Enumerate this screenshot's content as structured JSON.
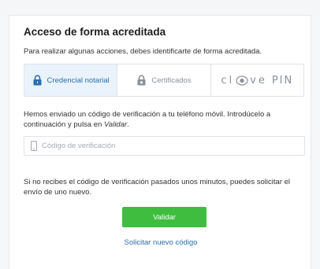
{
  "card": {
    "title": "Acceso de forma acreditada",
    "subtitle": "Para realizar algunas acciones, debes identificarte de forma acreditada."
  },
  "tabs": [
    {
      "label": "Credencial notarial",
      "icon": "lock-icon",
      "active": true
    },
    {
      "label": "Certificados",
      "icon": "certificate-lock-icon",
      "active": false
    },
    {
      "label_left": "cl",
      "label_right": "ve",
      "label_pin": "PIN",
      "icon": "clave-eye-logo",
      "active": false
    }
  ],
  "info": {
    "text_before": "Hemos enviado un código de verificación a tu teléfono móvil. Introdúcelo a continuación y pulsa en ",
    "emphasis": "Validar",
    "text_after": "."
  },
  "code_field": {
    "placeholder": "Código de verificación",
    "value": "",
    "icon": "phone-icon"
  },
  "notice": "Si no recibes el código de verificación pasados unos minutos, puedes solicitar el envío de uno nuevo.",
  "actions": {
    "validate_label": "Validar",
    "resend_label": "Solicitar nuevo código"
  },
  "colors": {
    "accent": "#2a6fb0",
    "active_tab_bg": "#eaf3fb",
    "button_green": "#3ebd3e",
    "muted": "#8a9099"
  }
}
